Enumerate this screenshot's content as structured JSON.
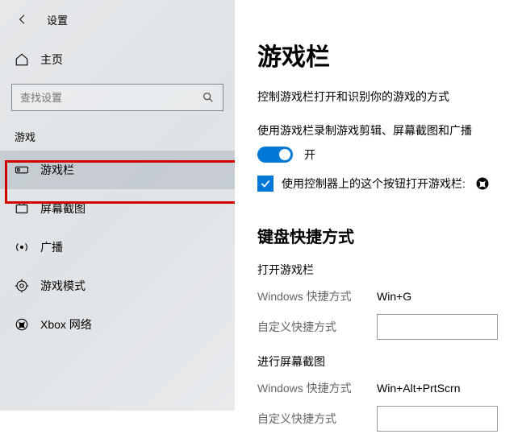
{
  "topbar": {
    "settings_label": "设置"
  },
  "home": {
    "label": "主页"
  },
  "search": {
    "placeholder": "查找设置"
  },
  "section": {
    "title": "游戏"
  },
  "nav": {
    "items": [
      {
        "label": "游戏栏"
      },
      {
        "label": "屏幕截图"
      },
      {
        "label": "广播"
      },
      {
        "label": "游戏模式"
      },
      {
        "label": "Xbox 网络"
      }
    ]
  },
  "main": {
    "title": "游戏栏",
    "desc": "控制游戏栏打开和识别你的游戏的方式",
    "toggle_caption": "使用游戏栏录制游戏剪辑、屏幕截图和广播",
    "toggle_state": "开",
    "checkbox_label": "使用控制器上的这个按钮打开游戏栏:",
    "subhead": "键盘快捷方式",
    "open_section": "打开游戏栏",
    "win_shortcut_label": "Windows 快捷方式",
    "custom_shortcut_label": "自定义快捷方式",
    "open_shortcut_value": "Win+G",
    "screenshot_section": "进行屏幕截图",
    "screenshot_shortcut_value": "Win+Alt+PrtScrn"
  }
}
